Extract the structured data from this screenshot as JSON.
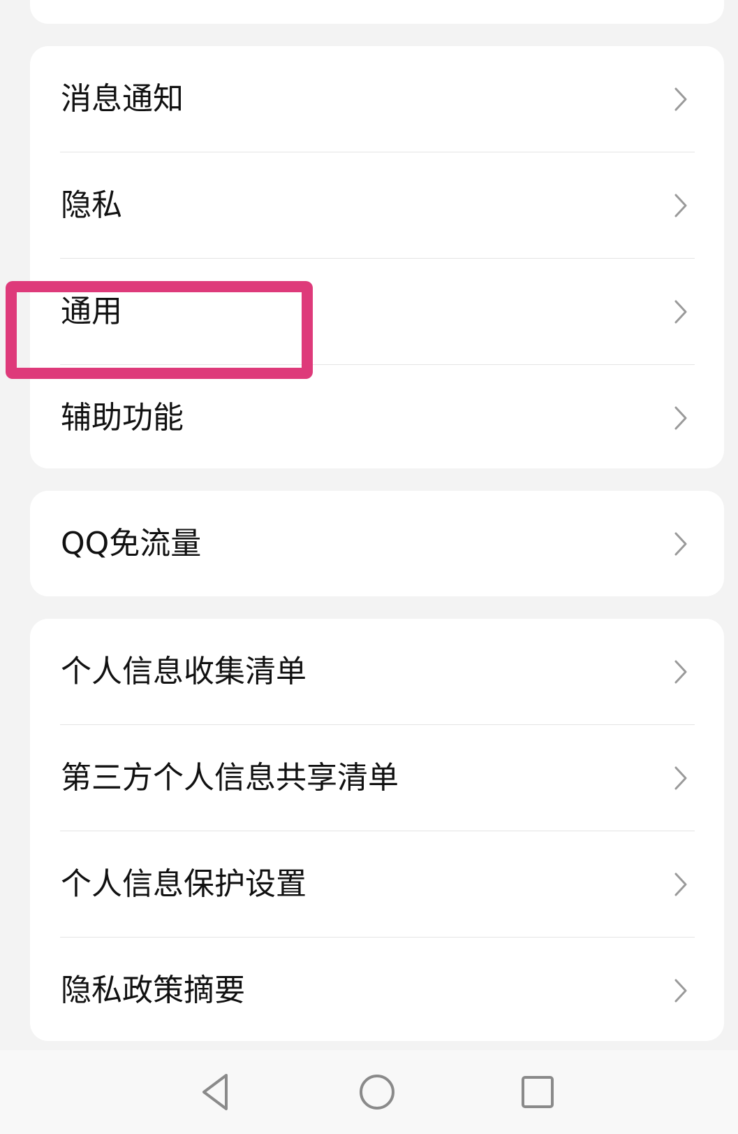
{
  "settings": {
    "groups": [
      {
        "items": [
          {
            "label": "消息通知"
          },
          {
            "label": "隐私"
          },
          {
            "label": "通用"
          },
          {
            "label": "辅助功能"
          }
        ]
      },
      {
        "items": [
          {
            "label": "QQ免流量"
          }
        ]
      },
      {
        "items": [
          {
            "label": "个人信息收集清单"
          },
          {
            "label": "第三方个人信息共享清单"
          },
          {
            "label": "个人信息保护设置"
          },
          {
            "label": "隐私政策摘要"
          }
        ]
      }
    ],
    "highlighted_item": "通用"
  },
  "navbar": {
    "buttons": [
      {
        "icon": "back-triangle-icon"
      },
      {
        "icon": "home-circle-icon"
      },
      {
        "icon": "recents-square-icon"
      }
    ]
  },
  "colors": {
    "background": "#f3f3f3",
    "card": "#ffffff",
    "divider": "#e4e4e4",
    "chevron": "#9a9a9a",
    "highlight": "#de3a7a",
    "nav_icon": "#8a8a8a"
  }
}
